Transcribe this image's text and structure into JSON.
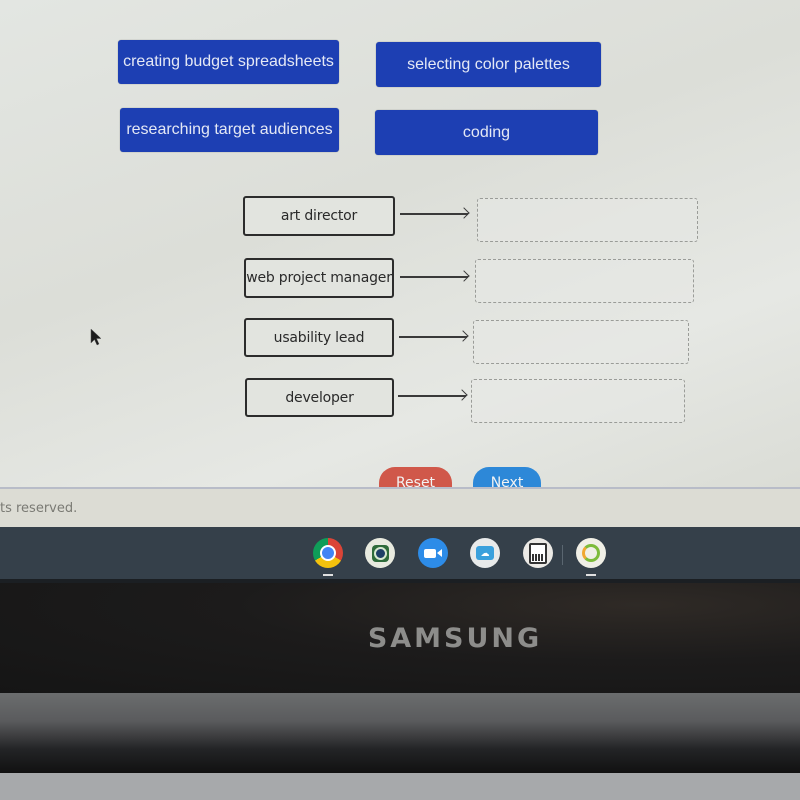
{
  "answer_tiles": [
    {
      "label": "creating budget spreadsheets"
    },
    {
      "label": "selecting color palettes"
    },
    {
      "label": "researching target audiences"
    },
    {
      "label": "coding"
    }
  ],
  "matching_rows": [
    {
      "term": "art director",
      "answer": ""
    },
    {
      "term": "web project manager",
      "answer": ""
    },
    {
      "term": "usability lead",
      "answer": ""
    },
    {
      "term": "developer",
      "answer": ""
    }
  ],
  "buttons": {
    "reset_label": "Reset",
    "next_label": "Next"
  },
  "footer": {
    "copyright_text": "ts reserved."
  },
  "shelf": {
    "apps": [
      {
        "name": "chrome-icon",
        "active": true
      },
      {
        "name": "camera-app-icon",
        "active": false
      },
      {
        "name": "zoom-video-icon",
        "active": false
      },
      {
        "name": "cloud-app-icon",
        "active": false
      },
      {
        "name": "calculator-icon",
        "active": false
      },
      {
        "name": "circle-app-icon",
        "active": true
      }
    ]
  },
  "device": {
    "brand": "SAMSUNG"
  },
  "colors": {
    "tile_blue": "#1d3fb3",
    "reset_red": "#d0584a",
    "next_blue": "#2d88d8"
  }
}
